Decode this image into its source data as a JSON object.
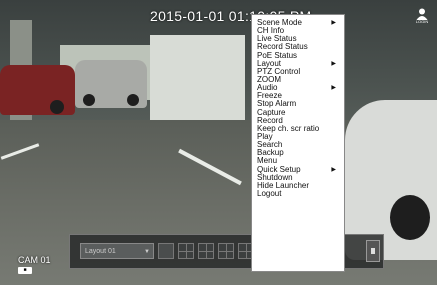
{
  "timestamp": "2015-01-01 01:10:05 PM",
  "login_label": "LOGIN",
  "camera": {
    "name": "CAM 01",
    "icon": "camera-icon"
  },
  "launcher": {
    "layout_value": "Layout 01"
  },
  "context_menu": {
    "items": [
      {
        "label": "Scene Mode",
        "has_submenu": true
      },
      {
        "label": "CH Info",
        "has_submenu": false
      },
      {
        "label": "Live Status",
        "has_submenu": false
      },
      {
        "label": "Record Status",
        "has_submenu": false
      },
      {
        "label": "PoE Status",
        "has_submenu": false
      },
      {
        "label": "Layout",
        "has_submenu": true
      },
      {
        "label": "PTZ Control",
        "has_submenu": false
      },
      {
        "label": "ZOOM",
        "has_submenu": false
      },
      {
        "label": "Audio",
        "has_submenu": true
      },
      {
        "label": "Freeze",
        "has_submenu": false
      },
      {
        "label": "Stop Alarm",
        "has_submenu": false
      },
      {
        "label": "Capture",
        "has_submenu": false
      },
      {
        "label": "Record",
        "has_submenu": false
      },
      {
        "label": "Keep ch. scr ratio",
        "has_submenu": false
      },
      {
        "label": "Play",
        "has_submenu": false
      },
      {
        "label": "Search",
        "has_submenu": false
      },
      {
        "label": "Backup",
        "has_submenu": false
      },
      {
        "label": "Menu",
        "has_submenu": false
      },
      {
        "label": "Quick Setup",
        "has_submenu": true
      },
      {
        "label": "Shutdown",
        "has_submenu": false
      },
      {
        "label": "Hide Launcher",
        "has_submenu": false
      },
      {
        "label": "Logout",
        "has_submenu": false
      }
    ],
    "submenu_arrow": "▶"
  }
}
